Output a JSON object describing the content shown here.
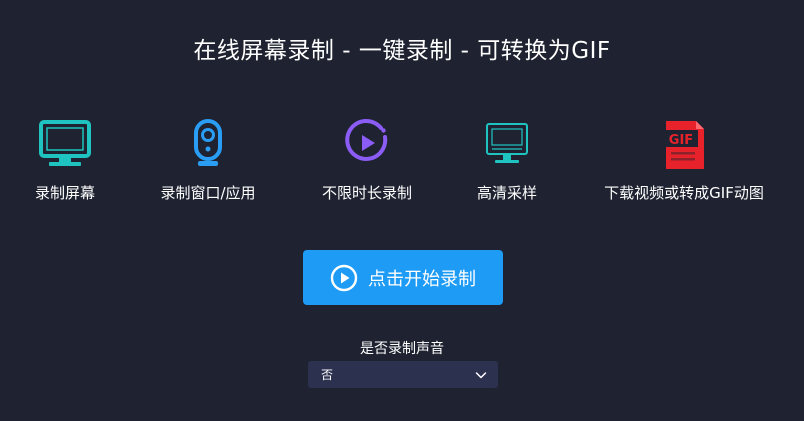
{
  "header": {
    "title": "在线屏幕录制 - 一键录制 - 可转换为GIF"
  },
  "features": [
    {
      "label": "录制屏幕",
      "icon": "monitor-icon",
      "color": "#1fc4c0"
    },
    {
      "label": "录制窗口/应用",
      "icon": "webcam-icon",
      "color": "#2a9df4"
    },
    {
      "label": "不限时长录制",
      "icon": "play-circle-icon",
      "color": "#8b5cf6"
    },
    {
      "label": "高清采样",
      "icon": "hd-monitor-icon",
      "color": "#1fc4c0"
    },
    {
      "label": "下载视频或转成GIF动图",
      "icon": "gif-file-icon",
      "color": "#e8222b",
      "icon_text": "GIF"
    }
  ],
  "record_button": {
    "label": "点击开始录制",
    "icon": "play-circle-icon",
    "color": "#1e9bf5"
  },
  "sound": {
    "label": "是否录制声音",
    "selected": "否",
    "icon": "chevron-down-icon"
  }
}
